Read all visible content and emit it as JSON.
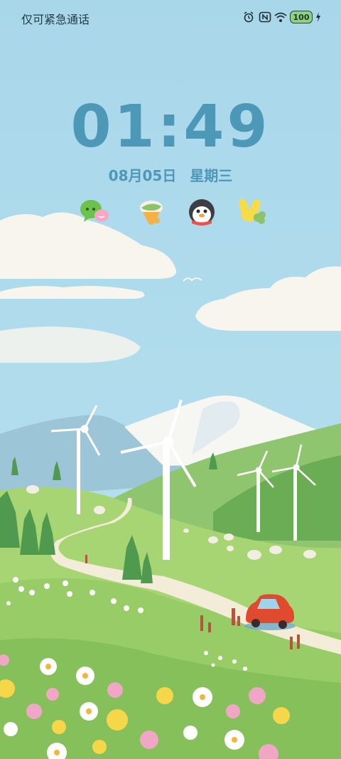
{
  "status_bar": {
    "carrier": "仅可紧急通话",
    "battery": "100",
    "icons": [
      "alarm-icon",
      "nfc-icon",
      "wifi-icon",
      "battery-icon",
      "charging-icon"
    ]
  },
  "lockscreen": {
    "time": "01:49",
    "date": "08月05日",
    "weekday": "星期三"
  },
  "shortcuts": [
    {
      "name": "wechat-icon"
    },
    {
      "name": "ice-cream-app-icon"
    },
    {
      "name": "penguin-app-icon"
    },
    {
      "name": "flower-app-icon"
    }
  ],
  "colors": {
    "sky": "#a6d6ec",
    "clock": "#4d97b7",
    "grass": "#9fd06a"
  }
}
